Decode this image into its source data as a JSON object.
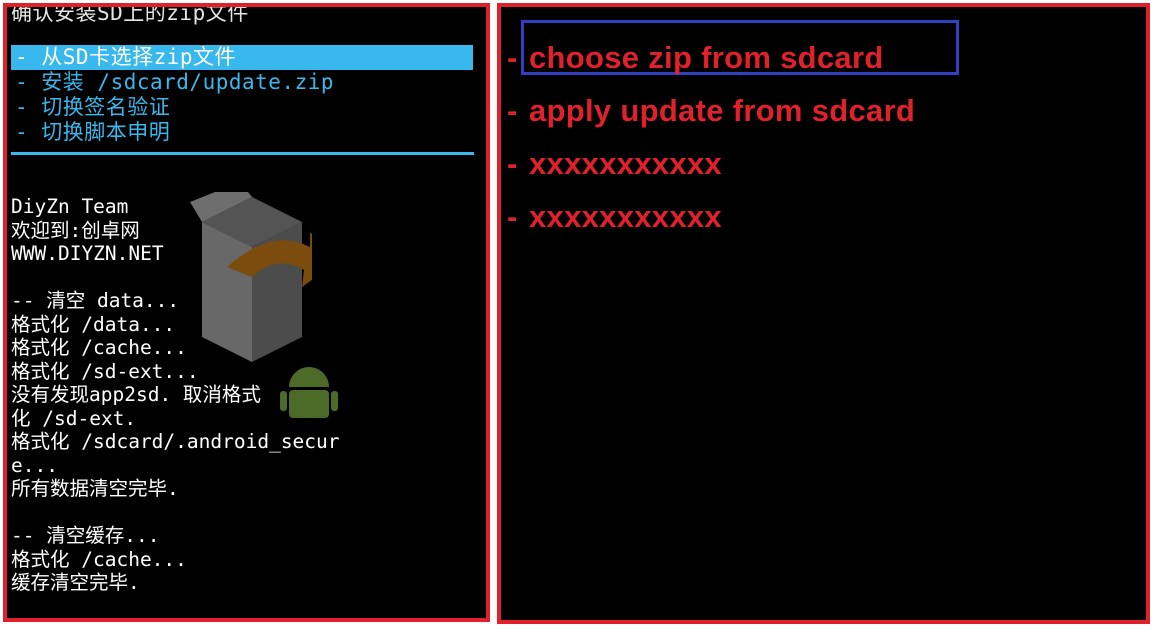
{
  "left_panel": {
    "clipped_title": "确认安装SD上的zip文件",
    "menu": [
      {
        "label": "- 从SD卡选择zip文件",
        "selected": true
      },
      {
        "label": "- 安装 /sdcard/update.zip",
        "selected": false
      },
      {
        "label": "- 切换签名验证",
        "selected": false
      },
      {
        "label": "- 切换脚本申明",
        "selected": false
      }
    ],
    "log_lines": [
      "DiyZn Team",
      "欢迎到:创卓网",
      "WWW.DIYZN.NET",
      "",
      "-- 清空 data...",
      "格式化 /data...",
      "格式化 /cache...",
      "格式化 /sd-ext...",
      "没有发现app2sd. 取消格式",
      "化 /sd-ext.",
      "格式化 /sdcard/.android_secur",
      "e...",
      "所有数据清空完毕.",
      "",
      "-- 清空缓存...",
      "格式化 /cache...",
      "缓存清空完毕."
    ]
  },
  "right_panel": {
    "dash": "-",
    "items": [
      {
        "label": "choose zip from sdcard",
        "highlighted": true
      },
      {
        "label": "apply update from sdcard",
        "highlighted": false
      },
      {
        "label": "xxxxxxxxxxx",
        "highlighted": false
      },
      {
        "label": "xxxxxxxxxxx",
        "highlighted": false
      }
    ]
  },
  "colors": {
    "frame_border": "#e0202a",
    "menu_cyan": "#38b8ec",
    "highlight_box": "#3040c0",
    "english_text": "#e0202a"
  },
  "icons": [
    "box-with-arrow-logo-icon",
    "android-robot-icon"
  ]
}
